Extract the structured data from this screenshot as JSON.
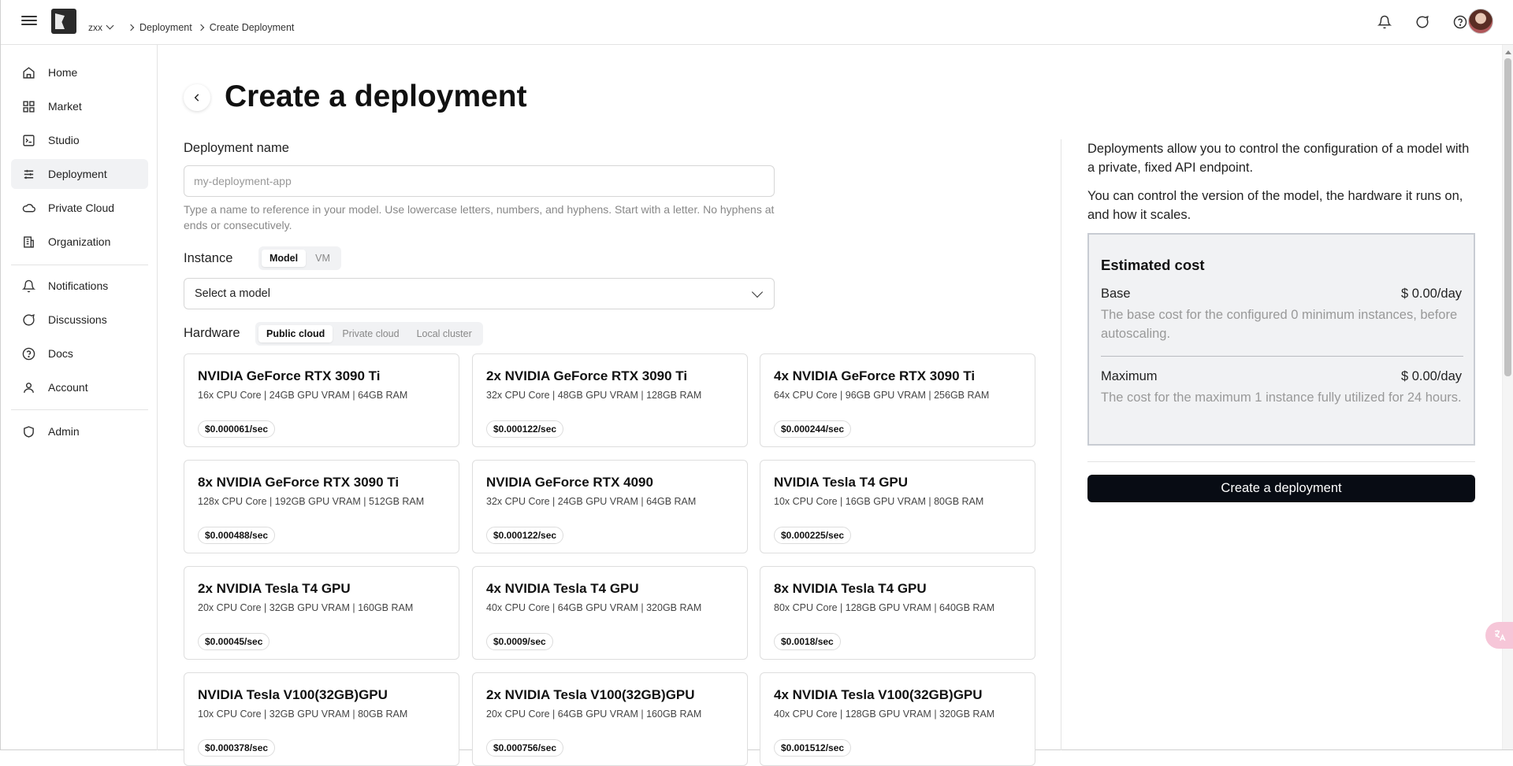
{
  "topbar": {
    "org": "zxx",
    "breadcrumb": [
      "Deployment",
      "Create Deployment"
    ]
  },
  "sidebar": {
    "items": [
      {
        "label": "Home",
        "icon": "home-icon"
      },
      {
        "label": "Market",
        "icon": "grid-icon"
      },
      {
        "label": "Studio",
        "icon": "terminal-icon"
      },
      {
        "label": "Deployment",
        "icon": "sliders-icon"
      },
      {
        "label": "Private Cloud",
        "icon": "cloud-icon"
      },
      {
        "label": "Organization",
        "icon": "building-icon"
      },
      {
        "label": "Notifications",
        "icon": "bell-icon"
      },
      {
        "label": "Discussions",
        "icon": "chat-icon"
      },
      {
        "label": "Docs",
        "icon": "help-icon"
      },
      {
        "label": "Account",
        "icon": "user-icon"
      },
      {
        "label": "Admin",
        "icon": "shield-icon"
      }
    ],
    "active": "Deployment"
  },
  "main": {
    "title": "Create a deployment",
    "deployment_name_label": "Deployment name",
    "deployment_name_placeholder": "my-deployment-app",
    "deployment_name_value": "",
    "hint": "Type a name to reference in your model. Use lowercase letters, numbers, and hyphens. Start with a letter. No hyphens at ends or consecutively.",
    "instance_label": "Instance",
    "instance_options": [
      "Model",
      "VM"
    ],
    "instance_selected": "Model",
    "model_select_placeholder": "Select a model",
    "hardware_label": "Hardware",
    "hardware_options": [
      "Public cloud",
      "Private cloud",
      "Local cluster"
    ],
    "hardware_selected": "Public cloud",
    "cards": [
      {
        "title": "NVIDIA GeForce RTX 3090 Ti",
        "spec": "16x CPU Core | 24GB GPU VRAM | 64GB RAM",
        "price": "$0.000061/sec"
      },
      {
        "title": "2x NVIDIA GeForce RTX 3090 Ti",
        "spec": "32x CPU Core | 48GB GPU VRAM | 128GB RAM",
        "price": "$0.000122/sec"
      },
      {
        "title": "4x NVIDIA GeForce RTX 3090 Ti",
        "spec": "64x CPU Core | 96GB GPU VRAM | 256GB RAM",
        "price": "$0.000244/sec"
      },
      {
        "title": "8x NVIDIA GeForce RTX 3090 Ti",
        "spec": "128x CPU Core | 192GB GPU VRAM | 512GB RAM",
        "price": "$0.000488/sec"
      },
      {
        "title": "NVIDIA GeForce RTX 4090",
        "spec": "32x CPU Core | 24GB GPU VRAM | 64GB RAM",
        "price": "$0.000122/sec"
      },
      {
        "title": "NVIDIA Tesla T4 GPU",
        "spec": "10x CPU Core | 16GB GPU VRAM | 80GB RAM",
        "price": "$0.000225/sec"
      },
      {
        "title": "2x NVIDIA Tesla T4 GPU",
        "spec": "20x CPU Core | 32GB GPU VRAM | 160GB RAM",
        "price": "$0.00045/sec"
      },
      {
        "title": "4x NVIDIA Tesla T4 GPU",
        "spec": "40x CPU Core | 64GB GPU VRAM | 320GB RAM",
        "price": "$0.0009/sec"
      },
      {
        "title": "8x NVIDIA Tesla T4 GPU",
        "spec": "80x CPU Core | 128GB GPU VRAM | 640GB RAM",
        "price": "$0.0018/sec"
      },
      {
        "title": "NVIDIA Tesla V100(32GB)GPU",
        "spec": "10x CPU Core | 32GB GPU VRAM | 80GB RAM",
        "price": "$0.000378/sec"
      },
      {
        "title": "2x NVIDIA Tesla V100(32GB)GPU",
        "spec": "20x CPU Core | 64GB GPU VRAM | 160GB RAM",
        "price": "$0.000756/sec"
      },
      {
        "title": "4x NVIDIA Tesla V100(32GB)GPU",
        "spec": "40x CPU Core | 128GB GPU VRAM | 320GB RAM",
        "price": "$0.001512/sec"
      }
    ]
  },
  "aside": {
    "intro_1": "Deployments allow you to control the configuration of a model with a private, fixed API endpoint.",
    "intro_2": "You can control the version of the model, the hardware it runs on, and how it scales.",
    "cost_title": "Estimated cost",
    "base_label": "Base",
    "base_value": "$ 0.00/day",
    "base_desc": "The base cost for the configured 0 minimum instances, before autoscaling.",
    "max_label": "Maximum",
    "max_value": "$ 0.00/day",
    "max_desc": "The cost for the maximum 1 instance fully utilized for 24 hours.",
    "create_button": "Create a deployment"
  },
  "colors": {
    "primary_button": "#080c14",
    "active_nav_bg": "#f1f2f4",
    "cost_box_bg": "#f1f2f4"
  }
}
